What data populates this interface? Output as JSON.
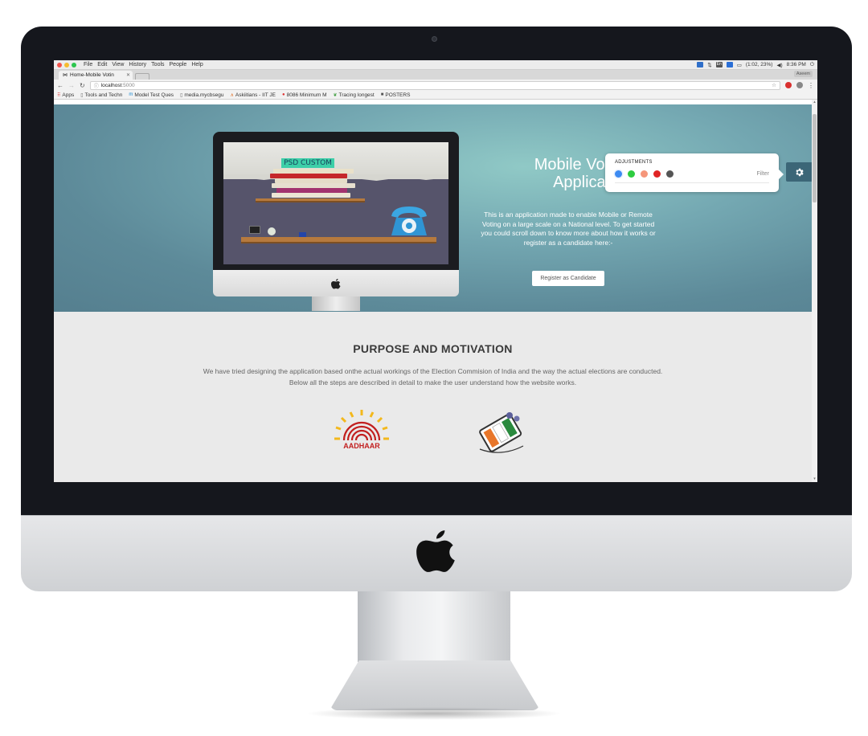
{
  "os_menu": {
    "items": [
      "File",
      "Edit",
      "View",
      "History",
      "Tools",
      "People",
      "Help"
    ],
    "battery": "(1:02, 23%)",
    "clock": "8:36 PM",
    "lang": "En"
  },
  "browser": {
    "tab_title": "Home-Mobile Votin",
    "profile": "Aseem",
    "url_host": "localhost",
    "url_port": ":5000"
  },
  "bookmarks": [
    {
      "label": "Apps",
      "icon": "apps-grid-icon"
    },
    {
      "label": "Tools and Techn",
      "icon": "page-icon"
    },
    {
      "label": "Model Test Ques",
      "icon": "m-icon"
    },
    {
      "label": "media.mycbsegu",
      "icon": "page-icon"
    },
    {
      "label": "Askiitians - IIT JE",
      "icon": "askiitians-icon"
    },
    {
      "label": "8086 Minimum M",
      "icon": "red-dot-icon"
    },
    {
      "label": "Tracing longest",
      "icon": "leaf-icon"
    },
    {
      "label": "POSTERS",
      "icon": "folder-icon"
    }
  ],
  "hero": {
    "title_line1": "Mobile Voting- A",
    "title_line2": "Application",
    "description": "This is an application made to enable Mobile or Remote Voting on a large scale on a National level. To get started you could scroll down to know more about how it works or register as a candidate here:-",
    "register_button": "Register as Candidate",
    "mockup_label": "PSD CUSTOM"
  },
  "adjustments": {
    "title": "ADJUSTMENTS",
    "filter_label": "Filter",
    "swatches": [
      "#3d8bf2",
      "#2ecc40",
      "#f5967a",
      "#e02424",
      "#555555"
    ]
  },
  "purpose": {
    "title": "PURPOSE AND MOTIVATION",
    "description": "We have tried designing the application based onthe actual workings of the Election Commision of India and the way the actual elections are conducted. Below all the steps are described in detail to make the user understand how the website works.",
    "aadhaar_label": "AADHAAR"
  },
  "colors": {
    "hero_teal": "#74a8b2",
    "gear_bg": "#3c6677",
    "section_bg": "#eaeaea"
  }
}
